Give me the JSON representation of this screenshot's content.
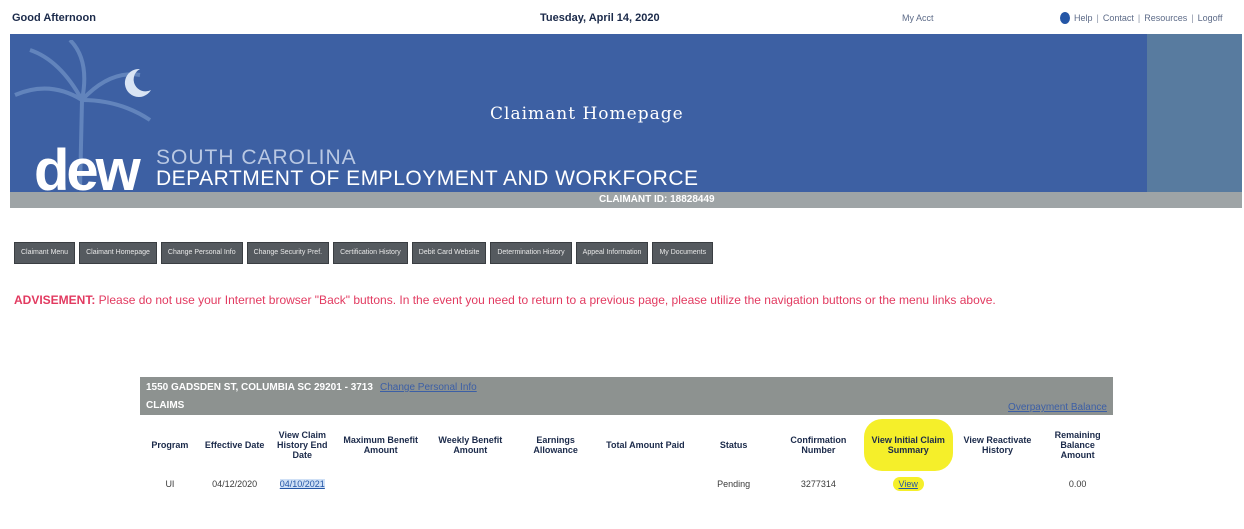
{
  "topbar": {
    "greeting": "Good Afternoon",
    "date": "Tuesday, April 14, 2020",
    "my_account": "My Acct",
    "links": [
      "Help",
      "Contact",
      "Resources",
      "Logoff"
    ]
  },
  "banner": {
    "title": "Claimant Homepage",
    "logo": "dew",
    "state": "SOUTH CAROLINA",
    "department": "DEPARTMENT OF EMPLOYMENT AND WORKFORCE",
    "claimant_id": "CLAIMANT ID: 18828449"
  },
  "nav": [
    "Claimant Menu",
    "Claimant Homepage",
    "Change Personal Info",
    "Change Security Pref.",
    "Certification History",
    "Debit Card Website",
    "Determination History",
    "Appeal Information",
    "My Documents"
  ],
  "advisement": {
    "label": "ADVISEMENT:",
    "text": " Please do not use your Internet browser \"Back\" buttons. In the event you need to return to a previous page, please utilize the navigation buttons or the menu links above."
  },
  "claim": {
    "address": "1550 GADSDEN ST, COLUMBIA SC 29201 - 3713",
    "change_link": "Change Personal Info",
    "claims_label": "CLAIMS",
    "overpayment_link": "Overpayment Balance",
    "headers": [
      "Program",
      "Effective Date",
      "View Claim History End Date",
      "Maximum Benefit Amount",
      "Weekly Benefit Amount",
      "Earnings Allowance",
      "Total Amount Paid",
      "Status",
      "Confirmation Number",
      "View Initial Claim Summary",
      "View Reactivate History",
      "Remaining Balance Amount"
    ],
    "row": {
      "program": "UI",
      "effective_date": "04/12/2020",
      "end_date": "04/10/2021",
      "status": "Pending",
      "confirmation": "3277314",
      "summary": "View",
      "remaining": "0.00"
    }
  },
  "colors": {
    "banner": "#3d60a3",
    "advisement": "#e23a60",
    "highlight": "#f5ef2a"
  }
}
